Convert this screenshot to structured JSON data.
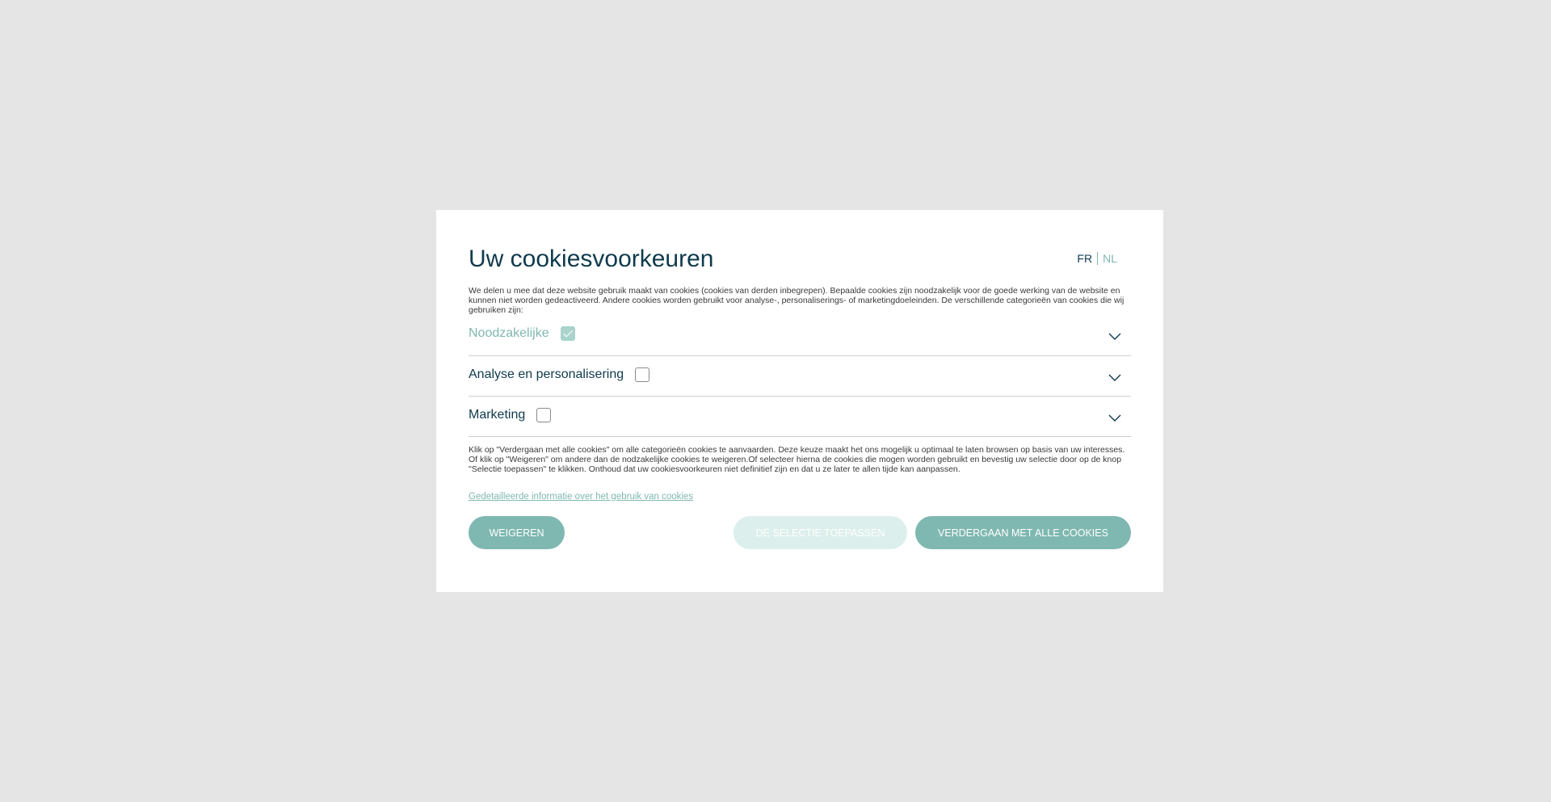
{
  "modal": {
    "title": "Uw cookiesvoorkeuren",
    "languages": {
      "fr": "FR",
      "nl": "NL"
    },
    "intro": "We delen u mee dat deze website gebruik maakt van cookies (cookies van derden inbegrepen). Bepaalde cookies zijn noodzakelijk voor de goede werking van de website en kunnen niet worden gedeactiveerd. Andere cookies worden gebruikt voor analyse-, personaliserings- of marketingdoeleinden. De verschillende categorieën van cookies die wij gebruiken zijn:",
    "categories": [
      {
        "label": "Noodzakelijke",
        "checked": true,
        "disabled": true
      },
      {
        "label": "Analyse en personalisering",
        "checked": false,
        "disabled": false
      },
      {
        "label": "Marketing",
        "checked": false,
        "disabled": false
      }
    ],
    "consent_text": "Klik op \"Verdergaan met alle cookies\" om alle categorieën cookies te aanvaarden. Deze keuze maakt het ons mogelijk u optimaal te laten browsen op basis van uw interesses. Of klik op \"Weigeren\" om andere dan de nodzakelijke cookies te weigeren.Of selecteer hierna de cookies die mogen worden gebruikt en bevestig uw selectie door op de knop \"Selectie toepassen\" te klikken. Onthoud dat uw cookiesvoorkeuren niet definitief zijn en dat u ze later te allen tijde kan aanpassen.",
    "detail_link": "Gedetailleerde informatie over het gebruik van cookies",
    "buttons": {
      "refuse": "WEIGEREN",
      "apply": "DE SELECTIE TOEPASSEN",
      "accept": "VERDERGAAN MET ALLE COOKIES"
    }
  },
  "colors": {
    "accent": "#7fb8b0",
    "accent_light": "#dcefec",
    "title": "#0f3a4d",
    "backdrop": "#e5e5e5"
  }
}
